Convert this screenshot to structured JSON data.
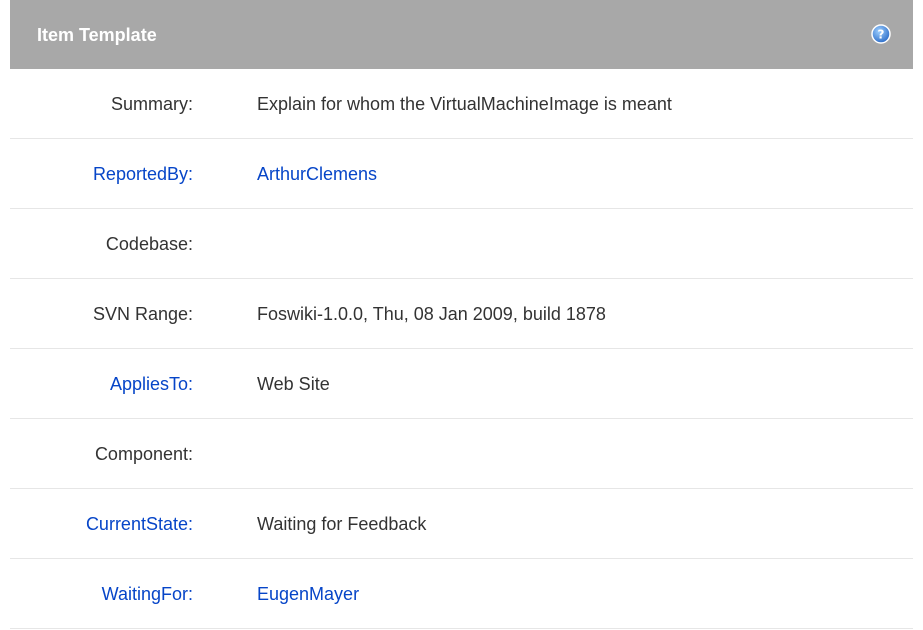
{
  "header": {
    "title": "Item Template",
    "help_icon": "question-circle-icon"
  },
  "colors": {
    "header_bg": "#a8a8a8",
    "link": "#0645c8",
    "text": "#333333",
    "help_icon": "#3b7fd6"
  },
  "rows": [
    {
      "label": "Summary:",
      "value": "Explain for whom the VirtualMachineImage is meant"
    },
    {
      "label": "ReportedBy:",
      "value": "ArthurClemens"
    },
    {
      "label": "Codebase:",
      "value": ""
    },
    {
      "label": "SVN Range:",
      "value": "Foswiki-1.0.0, Thu, 08 Jan 2009, build 1878"
    },
    {
      "label": "AppliesTo:",
      "value": "Web Site"
    },
    {
      "label": "Component:",
      "value": ""
    },
    {
      "label": "CurrentState:",
      "value": "Waiting for Feedback"
    },
    {
      "label": "WaitingFor:",
      "value": "EugenMayer"
    }
  ]
}
